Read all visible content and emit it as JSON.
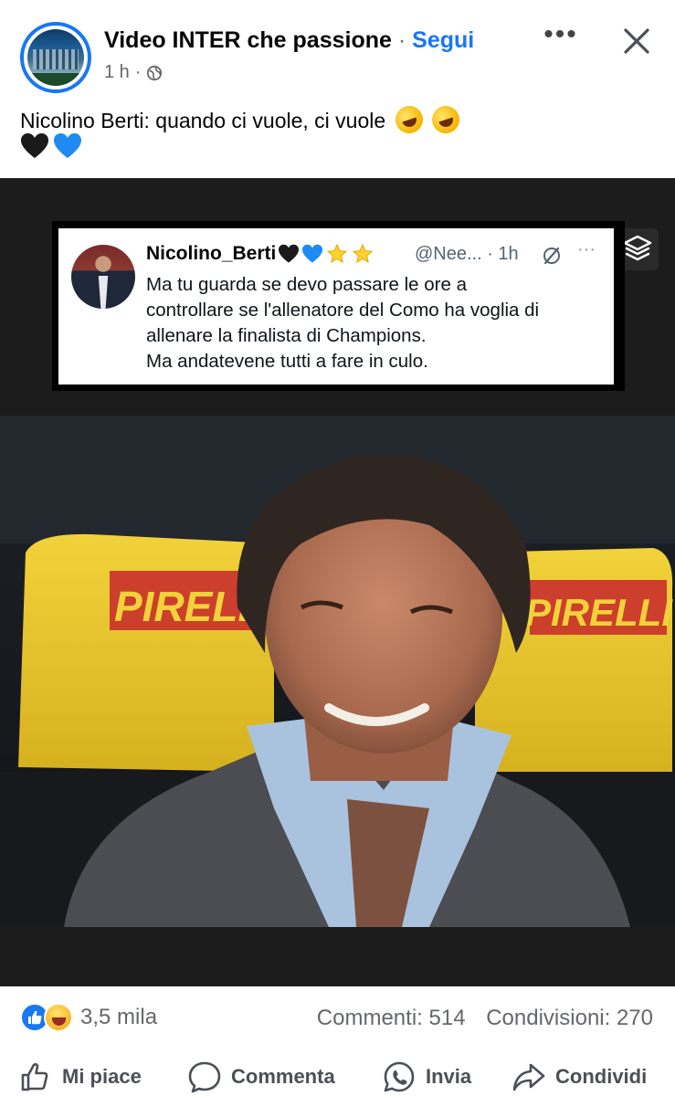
{
  "post": {
    "page_name": "Video INTER che passione",
    "separator": "·",
    "follow_label": "Segui",
    "time": "1 h",
    "meta_dot": "·",
    "more_label": "•••",
    "caption": "Nicolino Berti: quando ci vuole, ci vuole"
  },
  "tweet": {
    "name": "Nicolino_Berti",
    "handle": "@Nee... · 1h",
    "more": "···",
    "text_lines": [
      "Ma tu guarda se devo passare le ore a",
      "controllare se l'allenatore del Como ha voglia di",
      "allenare la finalista di Champions.",
      "Ma andatevene tutti a fare in culo."
    ],
    "photo_banner_text": "PIRELLI"
  },
  "stats": {
    "reactions_count": "3,5 mila",
    "comments": "Commenti: 514",
    "shares": "Condivisioni: 270"
  },
  "actions": {
    "like": "Mi piace",
    "comment": "Commenta",
    "send": "Invia",
    "share": "Condividi"
  },
  "colors": {
    "brand_blue": "#1877f2",
    "muted_text": "#65676b",
    "media_background": "#1c1c1c"
  }
}
